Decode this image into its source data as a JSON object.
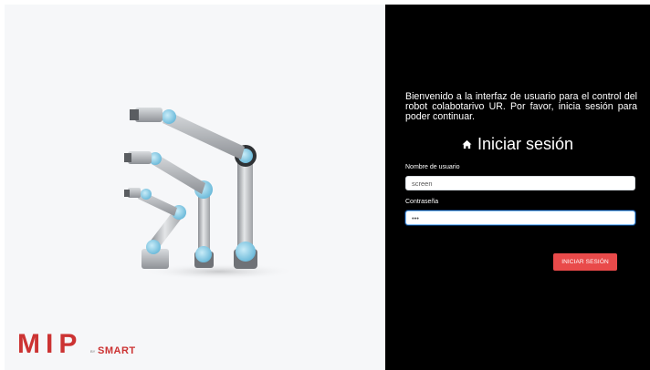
{
  "welcome_text": "Bienvenido a la interfaz de usuario para el control del robot colabotarivo UR. Por favor, inicia sesión para poder continuar.",
  "login": {
    "title": "Iniciar sesión",
    "title_icon": "home-icon",
    "username_label": "Nombre de usuario",
    "username_value": "screen",
    "password_label": "Contraseña",
    "password_value": "•••",
    "submit_label": "Iniciar sesión"
  },
  "brand": {
    "logo_main": "MIP",
    "logo_by": "BY",
    "logo_partner": "SMART"
  },
  "colors": {
    "accent": "#e94a4a",
    "panel_dark": "#000000",
    "panel_light": "#f6f7f9",
    "focus_ring": "#80bdff",
    "robot_joint": "#8fd0ea"
  }
}
